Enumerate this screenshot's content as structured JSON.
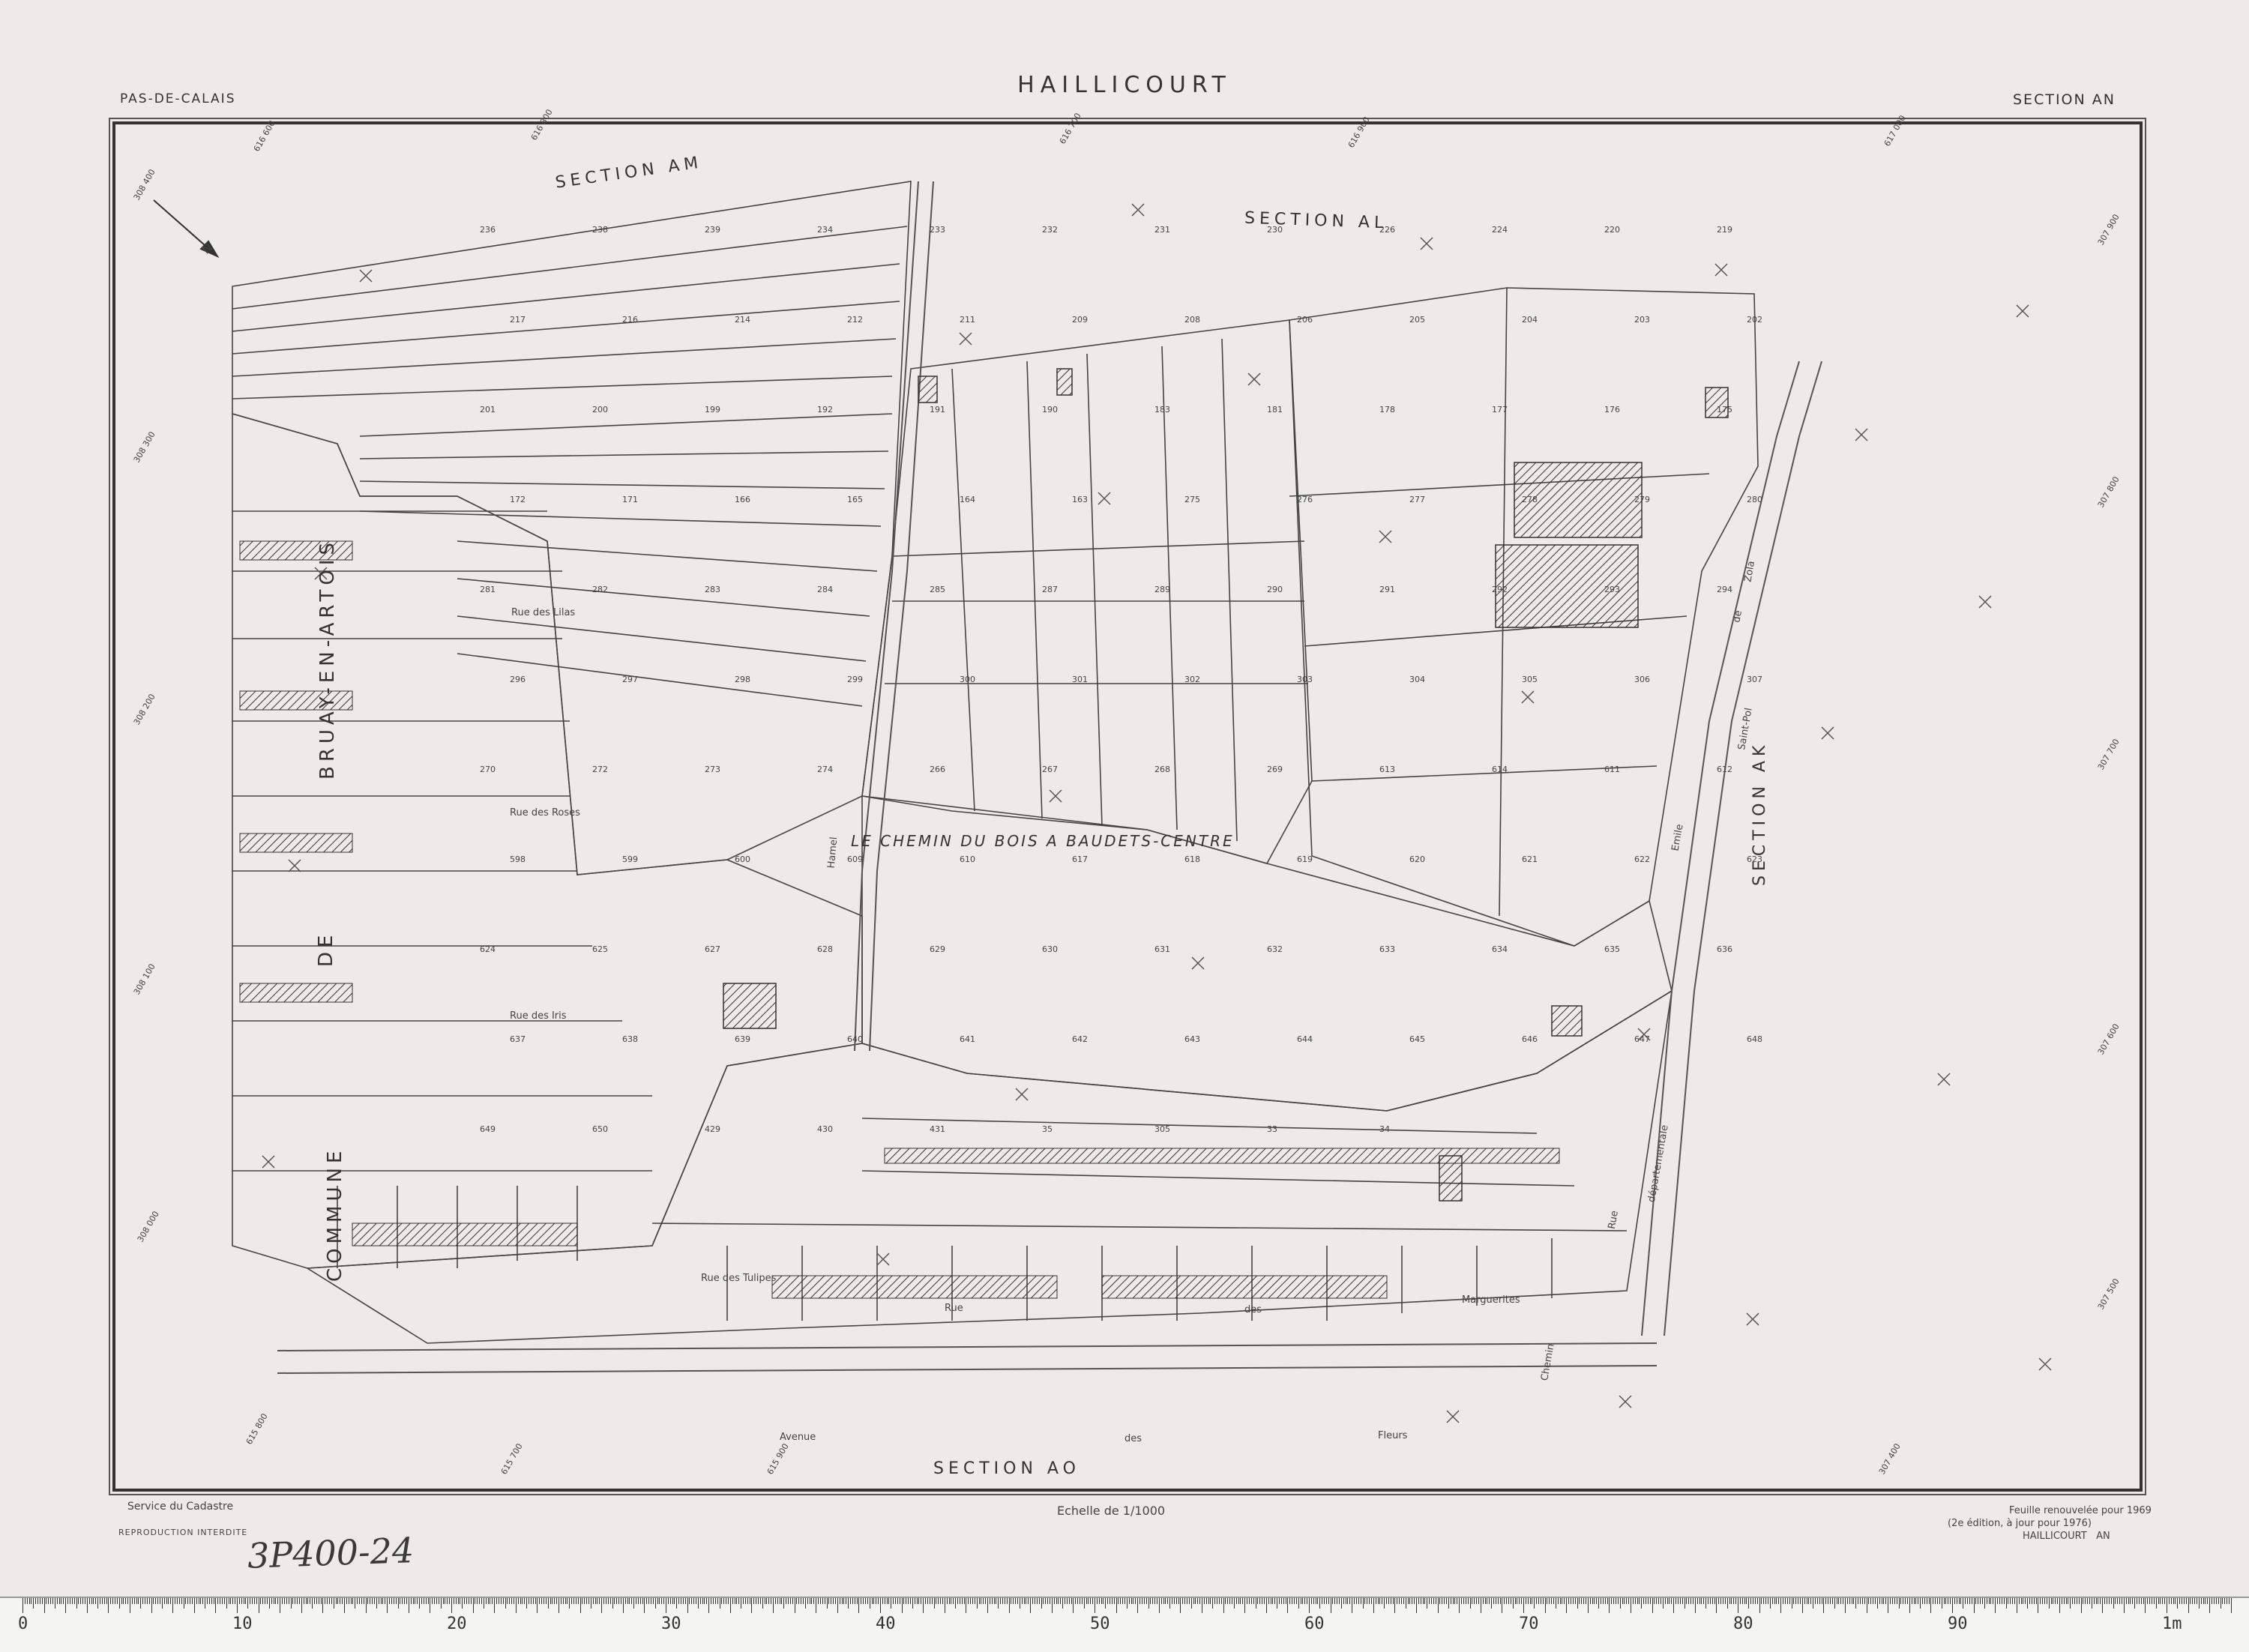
{
  "header": {
    "department": "PAS-DE-CALAIS",
    "commune": "HAILLICOURT",
    "section": "SECTION AN"
  },
  "map_labels": {
    "section_am": "SECTION AM",
    "section_al": "SECTION AL",
    "section_ak": "SECTION AK",
    "section_ao": "SECTION AO",
    "bruay": "BRUAY-EN-ARTOIS",
    "de": "DE",
    "commune": "COMMUNE",
    "lieu_dit": "LE CHEMIN DU BOIS A BAUDETS-CENTRE",
    "north": "N",
    "streets": {
      "lilas": "Rue des Lilas",
      "roses": "Rue des Roses",
      "iris": "Rue des Iris",
      "tulipes": "Rue des Tulipes",
      "rue_des_a": "Rue",
      "rue_des_b": "des",
      "marguerites": "Marguerites",
      "avenue": "Avenue",
      "des": "des",
      "fleurs": "Fleurs",
      "saint_pol": "Saint-Pol",
      "zola": "Zola",
      "emile": "Emile",
      "de": "de",
      "departementale": "départementale",
      "chemin": "Chemin",
      "hamel": "Hamel",
      "rue_v": "Rue"
    },
    "parcels": [
      "236",
      "238",
      "239",
      "234",
      "233",
      "232",
      "231",
      "230",
      "226",
      "224",
      "220",
      "219",
      "217",
      "216",
      "214",
      "212",
      "211",
      "209",
      "208",
      "206",
      "205",
      "204",
      "203",
      "202",
      "201",
      "200",
      "199",
      "192",
      "191",
      "190",
      "183",
      "181",
      "178",
      "177",
      "176",
      "175",
      "172",
      "171",
      "166",
      "165",
      "164",
      "163",
      "275",
      "276",
      "277",
      "278",
      "279",
      "280",
      "281",
      "282",
      "283",
      "284",
      "285",
      "287",
      "289",
      "290",
      "291",
      "292",
      "293",
      "294",
      "296",
      "297",
      "298",
      "299",
      "300",
      "301",
      "302",
      "303",
      "304",
      "305",
      "306",
      "307",
      "270",
      "272",
      "273",
      "274",
      "266",
      "267",
      "268",
      "269",
      "613",
      "614",
      "611",
      "612",
      "598",
      "599",
      "600",
      "609",
      "610",
      "617",
      "618",
      "619",
      "620",
      "621",
      "622",
      "623",
      "624",
      "625",
      "627",
      "628",
      "629",
      "630",
      "631",
      "632",
      "633",
      "634",
      "635",
      "636",
      "637",
      "638",
      "639",
      "640",
      "641",
      "642",
      "643",
      "644",
      "645",
      "646",
      "647",
      "648",
      "649",
      "650",
      "429",
      "430",
      "431",
      "35",
      "305",
      "33",
      "34"
    ],
    "coord_ticks": [
      "616 600",
      "616 800",
      "616 900",
      "616 700",
      "617 000",
      "308 400",
      "308 300",
      "308 200",
      "308 100",
      "308 000",
      "307 900",
      "307 800",
      "307 700",
      "307 600",
      "307 500",
      "307 400",
      "615 900",
      "615 800",
      "615 700"
    ]
  },
  "footer": {
    "service": "Service du Cadastre",
    "reproduction": "REPRODUCTION INTERDITE",
    "scale": "Echelle de 1/1000",
    "renewal_1": "Feuille renouvelée pour 1969",
    "renewal_2": "(2e édition, à jour pour 1976)",
    "commune_section": "HAILLICOURT   AN",
    "handwritten": "3P400-24"
  },
  "ruler": {
    "major_labels": [
      "0",
      "10",
      "20",
      "30",
      "40",
      "50",
      "60",
      "70",
      "80",
      "90",
      "1m"
    ]
  }
}
